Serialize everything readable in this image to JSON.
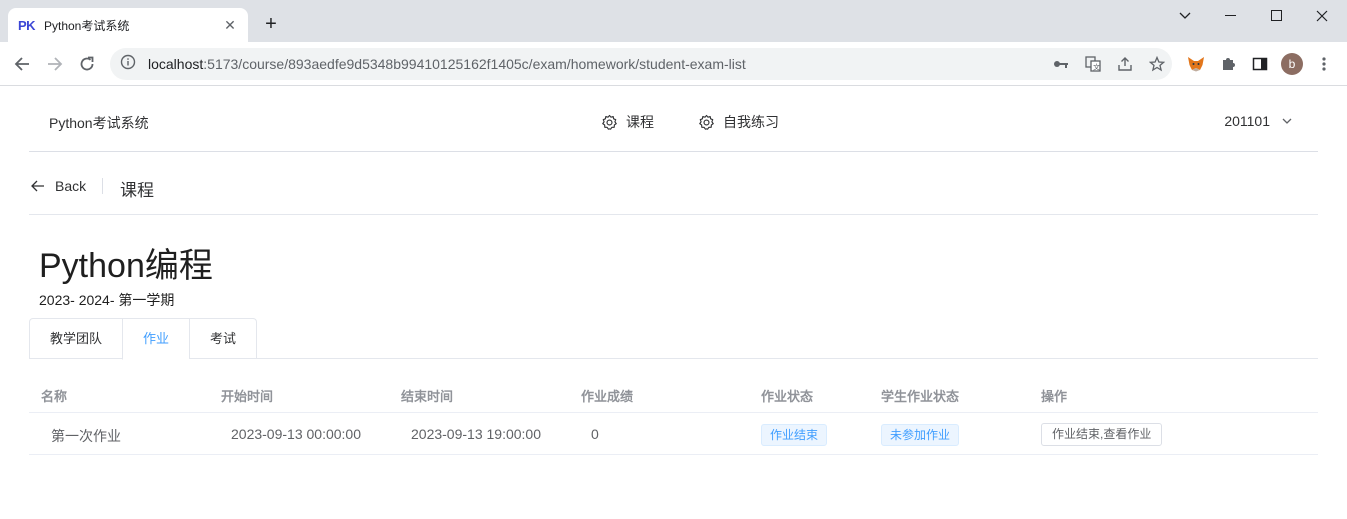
{
  "browser": {
    "tab_favicon": "PK",
    "tab_title": "Python考试系统",
    "url_host": "localhost",
    "url_rest": ":5173/course/893aedfe9d5348b99410125162f1405c/exam/homework/student-exam-list",
    "profile_initial": "b"
  },
  "header": {
    "brand": "Python考试系统",
    "menu": [
      {
        "label": "课程",
        "icon": "gear-icon"
      },
      {
        "label": "自我练习",
        "icon": "gear-icon"
      }
    ],
    "user": "201101"
  },
  "page_header": {
    "back_label": "Back",
    "title": "课程"
  },
  "course": {
    "title": "Python编程",
    "semester": "2023- 2024- 第一学期"
  },
  "tabs": [
    {
      "label": "教学团队",
      "active": false
    },
    {
      "label": "作业",
      "active": true
    },
    {
      "label": "考试",
      "active": false
    }
  ],
  "table": {
    "columns": [
      "名称",
      "开始时间",
      "结束时间",
      "作业成绩",
      "作业状态",
      "学生作业状态",
      "操作"
    ],
    "rows": [
      {
        "name": "第一次作业",
        "start": "2023-09-13 00:00:00",
        "end": "2023-09-13 19:00:00",
        "score": "0",
        "status": "作业结束",
        "student_status": "未参加作业",
        "action": "作业结束,查看作业"
      }
    ]
  },
  "colors": {
    "accent": "#409eff",
    "tag_bg": "#ecf5ff"
  }
}
